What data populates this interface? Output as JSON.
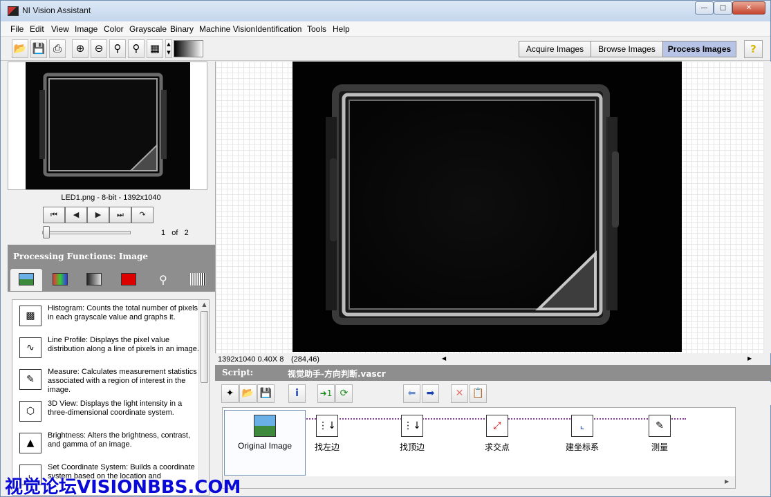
{
  "window": {
    "title": "NI Vision Assistant"
  },
  "menu": [
    "File",
    "Edit",
    "View",
    "Image",
    "Color",
    "Grayscale",
    "Binary",
    "Machine Vision",
    "Identification",
    "Tools",
    "Help"
  ],
  "mode_tabs": [
    {
      "label": "Acquire Images",
      "active": false
    },
    {
      "label": "Browse Images",
      "active": false
    },
    {
      "label": "Process Images",
      "active": true
    }
  ],
  "help_label": "?",
  "thumbnail": {
    "caption": "LED1.png - 8-bit - 1392x1040"
  },
  "navigator": {
    "current": "1",
    "of_label": "of",
    "total": "2"
  },
  "processing_functions": {
    "header": "Processing Functions: Image",
    "items": [
      {
        "icon": "histogram-icon",
        "text": "Histogram:  Counts the total number of pixels in each grayscale value and graphs it."
      },
      {
        "icon": "line-profile-icon",
        "text": "Line Profile:  Displays the pixel value distribution along a line of pixels in an image."
      },
      {
        "icon": "measure-icon",
        "text": "Measure:  Calculates measurement statistics associated with a region of interest in the image."
      },
      {
        "icon": "3d-view-icon",
        "text": "3D View:  Displays the light intensity in a three-dimensional coordinate system."
      },
      {
        "icon": "brightness-icon",
        "text": "Brightness:  Alters the brightness, contrast, and gamma of an image."
      },
      {
        "icon": "coordinate-system-icon",
        "text": "Set Coordinate System:  Builds a coordinate system based on the location and"
      }
    ]
  },
  "status": {
    "size_zoom": "1392x1040 0.40X 8",
    "coords": "(284,46)"
  },
  "script": {
    "label": "Script:",
    "filename": "视觉助手-方向判断.vascr",
    "steps": [
      {
        "label": "Original Image"
      },
      {
        "label": "找左边"
      },
      {
        "label": "找顶边"
      },
      {
        "label": "求交点"
      },
      {
        "label": "建坐标系"
      },
      {
        "label": "测量"
      }
    ]
  },
  "watermark": "视觉论坛VISIONBBS.COM",
  "colors": {
    "accent": "#b8c4e6",
    "header_gray": "#8e8e8e",
    "script_line": "#8a3aa0",
    "watermark": "#0a0ad6"
  }
}
